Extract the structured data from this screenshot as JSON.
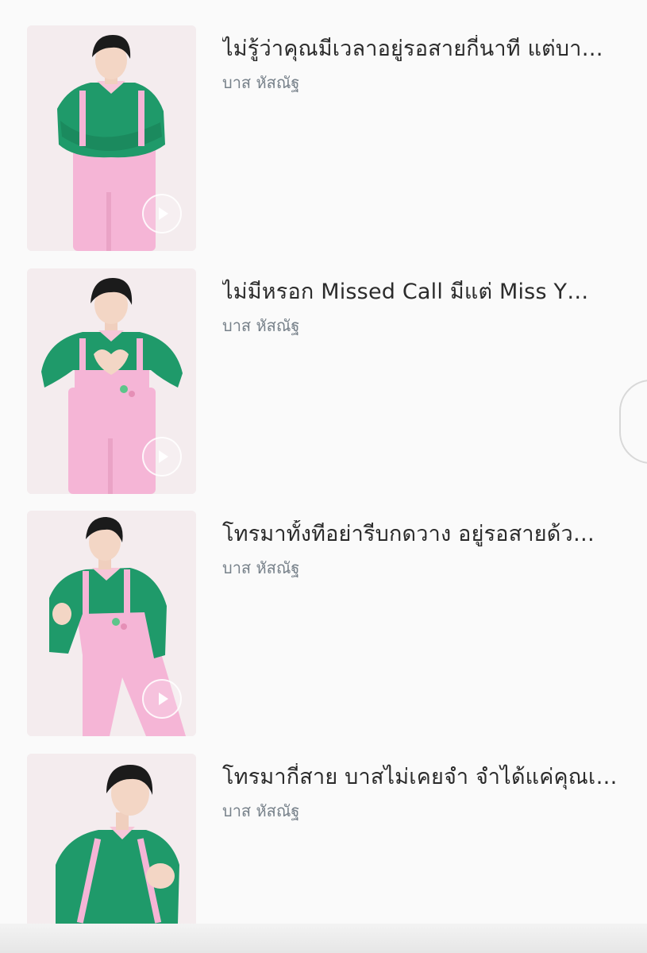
{
  "tracks": [
    {
      "title": "ไม่รู้ว่าคุณมีเวลาอยู่รอสายกี่นาที แต่บา…",
      "artist": "บาส หัสณัฐ",
      "pose": "arms-crossed"
    },
    {
      "title": "ไม่มีหรอก Missed Call มีแต่ Miss Y…",
      "artist": "บาส หัสณัฐ",
      "pose": "heart-hands"
    },
    {
      "title": "โทรมาทั้งทีอย่ารีบกดวาง อยู่รอสายด้ว…",
      "artist": "บาส หัสณัฐ",
      "pose": "finger-heart-pointing"
    },
    {
      "title": "โทรมากี่สาย บาสไม่เคยจำ จำได้แค่คุณเ…",
      "artist": "บาส หัสณัฐ",
      "pose": "mini-heart"
    }
  ],
  "icons": {
    "play": "play-icon"
  },
  "colors": {
    "thumb_bg": "#f3ebed",
    "sweater": "#1f9a6a",
    "overalls": "#f6b6d8",
    "hair": "#1b1b1b",
    "skin": "#f3d6c5",
    "title_text": "#2b2b2b",
    "artist_text": "#77818a"
  }
}
